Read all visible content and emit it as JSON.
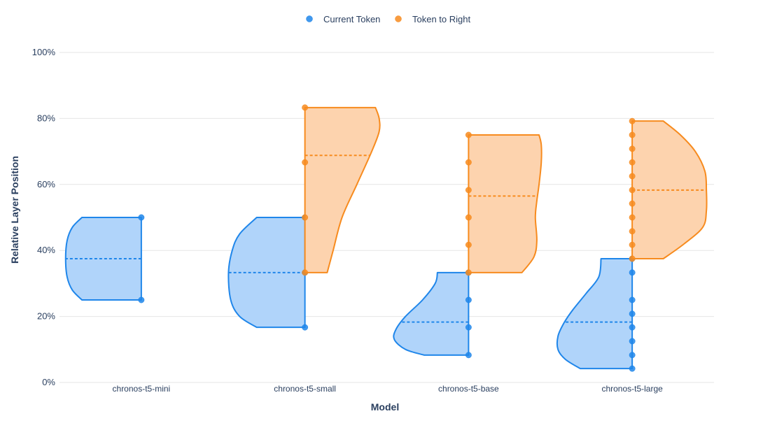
{
  "chart_data": {
    "type": "violin",
    "title": "",
    "xlabel": "Model",
    "ylabel": "Relative Layer Position",
    "categories": [
      "chronos-t5-mini",
      "chronos-t5-small",
      "chronos-t5-base",
      "chronos-t5-large"
    ],
    "ylim": [
      0,
      100
    ],
    "yticks": [
      0,
      20,
      40,
      60,
      80,
      100
    ],
    "ytick_suffix": "%",
    "grid": true,
    "legend_position": "top-center",
    "series": [
      {
        "name": "Current Token",
        "color": "#1f86ea",
        "fill": "#b0d4fa",
        "side": "negative",
        "violins": [
          {
            "category": "chronos-t5-mini",
            "points": [
              50,
              25
            ],
            "min": 25,
            "max": 50,
            "mean": 37.5,
            "profile": [
              [
                25,
                0.8
              ],
              [
                28,
                0.93
              ],
              [
                32,
                1.0
              ],
              [
                37.5,
                1.02
              ],
              [
                43,
                1.0
              ],
              [
                47,
                0.93
              ],
              [
                50,
                0.8
              ]
            ]
          },
          {
            "category": "chronos-t5-small",
            "points": [
              50,
              33.3,
              16.7
            ],
            "min": 16.7,
            "max": 50,
            "mean": 33.3,
            "profile": [
              [
                16.7,
                0.65
              ],
              [
                20,
                0.88
              ],
              [
                25,
                1.0
              ],
              [
                33.3,
                1.03
              ],
              [
                40,
                0.98
              ],
              [
                45,
                0.88
              ],
              [
                50,
                0.65
              ]
            ]
          },
          {
            "category": "chronos-t5-base",
            "points": [
              33.3,
              25,
              16.7,
              8.3
            ],
            "min": 8.3,
            "max": 33.3,
            "mean": 18.3,
            "profile": [
              [
                8.3,
                0.6
              ],
              [
                10,
                0.85
              ],
              [
                13,
                1.0
              ],
              [
                16,
                0.98
              ],
              [
                20,
                0.85
              ],
              [
                25,
                0.62
              ],
              [
                30,
                0.45
              ],
              [
                33.3,
                0.42
              ]
            ]
          },
          {
            "category": "chronos-t5-large",
            "points": [
              37.5,
              33.3,
              25,
              20.8,
              16.7,
              12.5,
              8.3,
              4.2
            ],
            "min": 4.2,
            "max": 37.5,
            "mean": 18.3,
            "profile": [
              [
                4.2,
                0.7
              ],
              [
                7,
                0.9
              ],
              [
                10,
                1.0
              ],
              [
                14,
                1.0
              ],
              [
                18,
                0.92
              ],
              [
                22,
                0.8
              ],
              [
                27,
                0.62
              ],
              [
                32,
                0.45
              ],
              [
                37.5,
                0.42
              ]
            ]
          }
        ]
      },
      {
        "name": "Token to Right",
        "color": "#f78b1e",
        "fill": "#fdd3ae",
        "side": "positive",
        "violins": [
          {
            "category": "chronos-t5-small",
            "points": [
              83.3,
              66.7,
              50,
              33.3
            ],
            "min": 33.3,
            "max": 83.3,
            "mean": 68.8,
            "profile": [
              [
                33.3,
                0.3
              ],
              [
                40,
                0.38
              ],
              [
                50,
                0.5
              ],
              [
                60,
                0.7
              ],
              [
                70,
                0.9
              ],
              [
                76,
                1.0
              ],
              [
                80,
                1.0
              ],
              [
                83.3,
                0.95
              ]
            ]
          },
          {
            "category": "chronos-t5-base",
            "points": [
              75,
              66.7,
              58.3,
              50,
              41.7,
              33.3
            ],
            "min": 33.3,
            "max": 75,
            "mean": 56.5,
            "profile": [
              [
                33.3,
                0.72
              ],
              [
                38,
                0.88
              ],
              [
                43,
                0.92
              ],
              [
                50,
                0.9
              ],
              [
                55,
                0.92
              ],
              [
                60,
                0.95
              ],
              [
                66.7,
                0.98
              ],
              [
                72,
                0.98
              ],
              [
                75,
                0.95
              ]
            ]
          },
          {
            "category": "chronos-t5-large",
            "points": [
              79.2,
              75,
              70.8,
              66.7,
              62.5,
              58.3,
              54.2,
              50,
              45.8,
              41.7,
              37.5
            ],
            "min": 37.5,
            "max": 79.2,
            "mean": 58.3,
            "profile": [
              [
                37.5,
                0.42
              ],
              [
                42,
                0.7
              ],
              [
                47,
                0.95
              ],
              [
                52,
                1.0
              ],
              [
                58.3,
                1.0
              ],
              [
                64,
                0.98
              ],
              [
                70,
                0.85
              ],
              [
                75,
                0.65
              ],
              [
                79.2,
                0.42
              ]
            ]
          }
        ]
      }
    ]
  }
}
